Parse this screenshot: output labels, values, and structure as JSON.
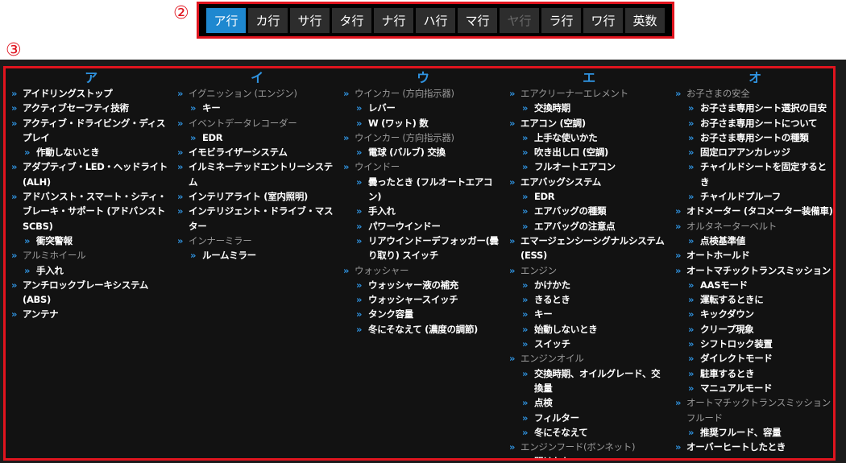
{
  "callouts": [
    "②",
    "③"
  ],
  "tabs": [
    {
      "label": "ア行",
      "state": "active"
    },
    {
      "label": "カ行",
      "state": "normal"
    },
    {
      "label": "サ行",
      "state": "normal"
    },
    {
      "label": "タ行",
      "state": "normal"
    },
    {
      "label": "ナ行",
      "state": "normal"
    },
    {
      "label": "ハ行",
      "state": "normal"
    },
    {
      "label": "マ行",
      "state": "normal"
    },
    {
      "label": "ヤ行",
      "state": "disabled"
    },
    {
      "label": "ラ行",
      "state": "normal"
    },
    {
      "label": "ワ行",
      "state": "normal"
    },
    {
      "label": "英数",
      "state": "normal"
    }
  ],
  "marker": "»",
  "colors": {
    "accent": "#1e88d0",
    "callout": "#e0141e",
    "heading": "#2f93e0",
    "group": "#9a9a9a"
  },
  "columns": [
    {
      "heading": "ア",
      "items": [
        {
          "text": "アイドリングストップ",
          "level": 1,
          "group": false
        },
        {
          "text": "アクティブセーフティ技術",
          "level": 1,
          "group": false
        },
        {
          "text": "アクティブ・ドライビング・ディスプレイ",
          "level": 1,
          "group": false
        },
        {
          "text": "作動しないとき",
          "level": 2,
          "group": false
        },
        {
          "text": "アダプティブ・LED・ヘッドライト(ALH)",
          "level": 1,
          "group": false
        },
        {
          "text": "アドバンスト・スマート・シティ・ブレーキ・サポート (アドバンストSCBS)",
          "level": 1,
          "group": false
        },
        {
          "text": "衝突警報",
          "level": 2,
          "group": false
        },
        {
          "text": "アルミホイール",
          "level": 1,
          "group": true
        },
        {
          "text": "手入れ",
          "level": 2,
          "group": false
        },
        {
          "text": "アンチロックブレーキシステム(ABS)",
          "level": 1,
          "group": false
        },
        {
          "text": "アンテナ",
          "level": 1,
          "group": false
        }
      ]
    },
    {
      "heading": "イ",
      "items": [
        {
          "text": "イグニッション (エンジン)",
          "level": 1,
          "group": true
        },
        {
          "text": "キー",
          "level": 2,
          "group": false
        },
        {
          "text": "イベントデータレコーダー",
          "level": 1,
          "group": true
        },
        {
          "text": "EDR",
          "level": 2,
          "group": false
        },
        {
          "text": "イモビライザーシステム",
          "level": 1,
          "group": false
        },
        {
          "text": "イルミネーテッドエントリーシステム",
          "level": 1,
          "group": false
        },
        {
          "text": "インテリアライト (室内照明)",
          "level": 1,
          "group": false
        },
        {
          "text": "インテリジェント・ドライブ・マスター",
          "level": 1,
          "group": false
        },
        {
          "text": "インナーミラー",
          "level": 1,
          "group": true
        },
        {
          "text": "ルームミラー",
          "level": 2,
          "group": false
        }
      ]
    },
    {
      "heading": "ウ",
      "items": [
        {
          "text": "ウインカー (方向指示器)",
          "level": 1,
          "group": true
        },
        {
          "text": "レバー",
          "level": 2,
          "group": false
        },
        {
          "text": "W (ワット) 数",
          "level": 2,
          "group": false
        },
        {
          "text": "ウインカー (方向指示器)",
          "level": 1,
          "group": true
        },
        {
          "text": "電球 (バルブ) 交換",
          "level": 2,
          "group": false
        },
        {
          "text": "ウインドー",
          "level": 1,
          "group": true
        },
        {
          "text": "曇ったとき (フルオートエアコン)",
          "level": 2,
          "group": false
        },
        {
          "text": "手入れ",
          "level": 2,
          "group": false
        },
        {
          "text": "パワーウインドー",
          "level": 2,
          "group": false
        },
        {
          "text": "リアウインドーデフォッガー(曇り取り) スイッチ",
          "level": 2,
          "group": false
        },
        {
          "text": "ウォッシャー",
          "level": 1,
          "group": true
        },
        {
          "text": "ウォッシャー液の補充",
          "level": 2,
          "group": false
        },
        {
          "text": "ウォッシャースイッチ",
          "level": 2,
          "group": false
        },
        {
          "text": "タンク容量",
          "level": 2,
          "group": false
        },
        {
          "text": "冬にそなえて (濃度の調節)",
          "level": 2,
          "group": false
        }
      ]
    },
    {
      "heading": "エ",
      "items": [
        {
          "text": "エアクリーナーエレメント",
          "level": 1,
          "group": true
        },
        {
          "text": "交換時期",
          "level": 2,
          "group": false
        },
        {
          "text": "エアコン (空調)",
          "level": 1,
          "group": false
        },
        {
          "text": "上手な使いかた",
          "level": 2,
          "group": false
        },
        {
          "text": "吹き出し口 (空調)",
          "level": 2,
          "group": false
        },
        {
          "text": "フルオートエアコン",
          "level": 2,
          "group": false
        },
        {
          "text": "エアバッグシステム",
          "level": 1,
          "group": false
        },
        {
          "text": "EDR",
          "level": 2,
          "group": false
        },
        {
          "text": "エアバッグの種類",
          "level": 2,
          "group": false
        },
        {
          "text": "エアバッグの注意点",
          "level": 2,
          "group": false
        },
        {
          "text": "エマージェンシーシグナルシステム (ESS)",
          "level": 1,
          "group": false
        },
        {
          "text": "エンジン",
          "level": 1,
          "group": true
        },
        {
          "text": "かけかた",
          "level": 2,
          "group": false
        },
        {
          "text": "きるとき",
          "level": 2,
          "group": false
        },
        {
          "text": "キー",
          "level": 2,
          "group": false
        },
        {
          "text": "始動しないとき",
          "level": 2,
          "group": false
        },
        {
          "text": "スイッチ",
          "level": 2,
          "group": false
        },
        {
          "text": "エンジンオイル",
          "level": 1,
          "group": true
        },
        {
          "text": "交換時期、オイルグレード、交換量",
          "level": 2,
          "group": false
        },
        {
          "text": "点検",
          "level": 2,
          "group": false
        },
        {
          "text": "フィルター",
          "level": 2,
          "group": false
        },
        {
          "text": "冬にそなえて",
          "level": 2,
          "group": false
        },
        {
          "text": "エンジンフード(ボンネット)",
          "level": 1,
          "group": true
        },
        {
          "text": "開けかた",
          "level": 2,
          "group": false
        }
      ]
    },
    {
      "heading": "オ",
      "items": [
        {
          "text": "お子さまの安全",
          "level": 1,
          "group": true
        },
        {
          "text": "お子さま専用シート選択の目安",
          "level": 2,
          "group": false
        },
        {
          "text": "お子さま専用シートについて",
          "level": 2,
          "group": false
        },
        {
          "text": "お子さま専用シートの種類",
          "level": 2,
          "group": false
        },
        {
          "text": "固定ロアアンカレッジ",
          "level": 2,
          "group": false
        },
        {
          "text": "チャイルドシートを固定するとき",
          "level": 2,
          "group": false
        },
        {
          "text": "チャイルドプルーフ",
          "level": 2,
          "group": false
        },
        {
          "text": "オドメーター (タコメーター装備車)",
          "level": 1,
          "group": false
        },
        {
          "text": "オルタネーターベルト",
          "level": 1,
          "group": true
        },
        {
          "text": "点検基準値",
          "level": 2,
          "group": false
        },
        {
          "text": "オートホールド",
          "level": 1,
          "group": false
        },
        {
          "text": "オートマチックトランスミッション",
          "level": 1,
          "group": false
        },
        {
          "text": "AASモード",
          "level": 2,
          "group": false
        },
        {
          "text": "運転するときに",
          "level": 2,
          "group": false
        },
        {
          "text": "キックダウン",
          "level": 2,
          "group": false
        },
        {
          "text": "クリープ現象",
          "level": 2,
          "group": false
        },
        {
          "text": "シフトロック装置",
          "level": 2,
          "group": false
        },
        {
          "text": "ダイレクトモード",
          "level": 2,
          "group": false
        },
        {
          "text": "駐車するとき",
          "level": 2,
          "group": false
        },
        {
          "text": "マニュアルモード",
          "level": 2,
          "group": false
        },
        {
          "text": "オートマチックトランスミッションフルード",
          "level": 1,
          "group": true
        },
        {
          "text": "推奨フルード、容量",
          "level": 2,
          "group": false
        },
        {
          "text": "オーバーヒートしたとき",
          "level": 1,
          "group": false
        }
      ]
    }
  ]
}
